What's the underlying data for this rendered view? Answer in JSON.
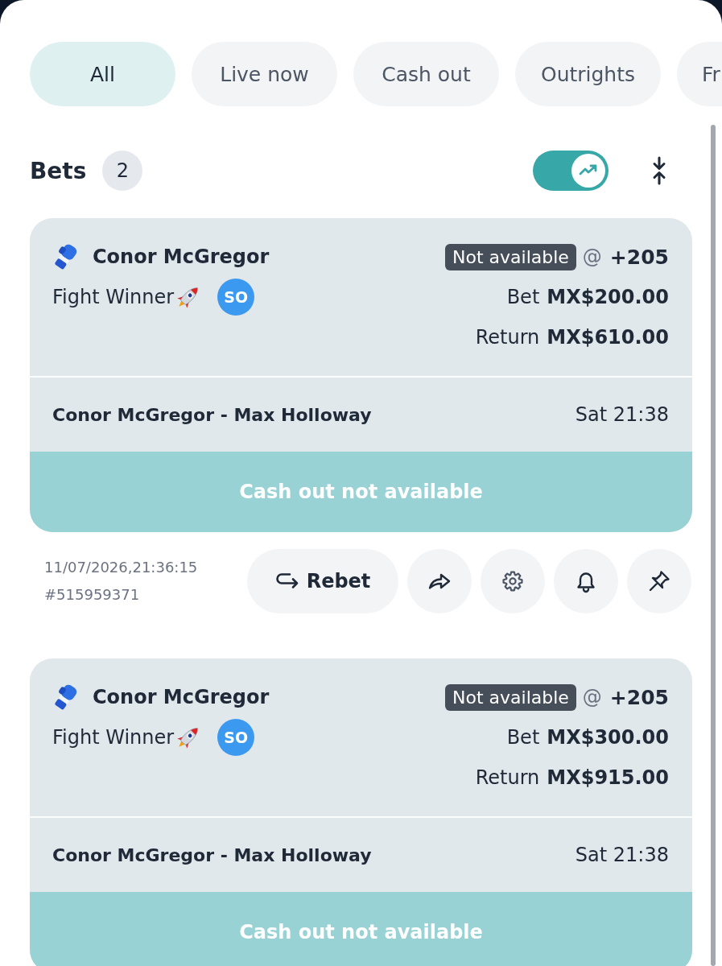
{
  "tabs": [
    {
      "label": "All",
      "selected": true
    },
    {
      "label": "Live now",
      "selected": false
    },
    {
      "label": "Cash out",
      "selected": false
    },
    {
      "label": "Outrights",
      "selected": false
    },
    {
      "label": "Fr",
      "selected": false
    }
  ],
  "header": {
    "title": "Bets",
    "count": "2",
    "trend_toggle": {
      "on": true
    }
  },
  "bets": [
    {
      "selection": "Conor McGregor",
      "market": "Fight Winner",
      "badge": "SO",
      "status": "Not available",
      "at": "@",
      "odds": "+205",
      "stake": {
        "label": "Bet",
        "amount": "MX$200.00"
      },
      "payout": {
        "label": "Return",
        "amount": "MX$610.00"
      },
      "event": "Conor McGregor - Max Holloway",
      "time": "Sat 21:38",
      "cash_out": "Cash out not available",
      "placed": "11/07/2026,21:36:15",
      "ref": "#515959371",
      "rebet": "Rebet"
    },
    {
      "selection": "Conor McGregor",
      "market": "Fight Winner",
      "badge": "SO",
      "status": "Not available",
      "at": "@",
      "odds": "+205",
      "stake": {
        "label": "Bet",
        "amount": "MX$300.00"
      },
      "payout": {
        "label": "Return",
        "amount": "MX$915.00"
      },
      "event": "Conor McGregor - Max Holloway",
      "time": "Sat 21:38",
      "cash_out": "Cash out not available"
    }
  ]
}
